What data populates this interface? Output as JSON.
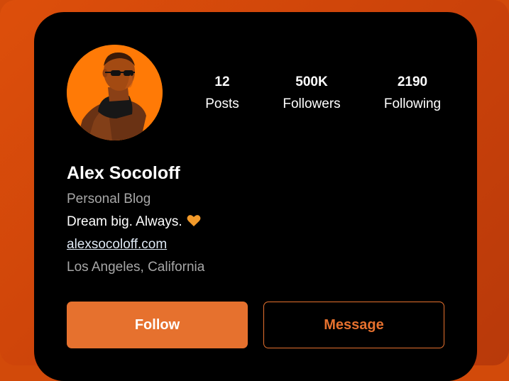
{
  "profile": {
    "name": "Alex Socoloff",
    "category": "Personal Blog",
    "bio": "Dream big. Always.",
    "bio_emoji_icon": "orange-heart-icon",
    "link": "alexsocoloff.com",
    "location": "Los Angeles, California"
  },
  "stats": [
    {
      "value": "12",
      "label": "Posts"
    },
    {
      "value": "500K",
      "label": "Followers"
    },
    {
      "value": "2190",
      "label": "Following"
    }
  ],
  "actions": {
    "follow_label": "Follow",
    "message_label": "Message"
  },
  "colors": {
    "background": "#d24a0a",
    "card": "#000000",
    "accent": "#e6712e",
    "avatar_bg": "#ff7a06"
  }
}
